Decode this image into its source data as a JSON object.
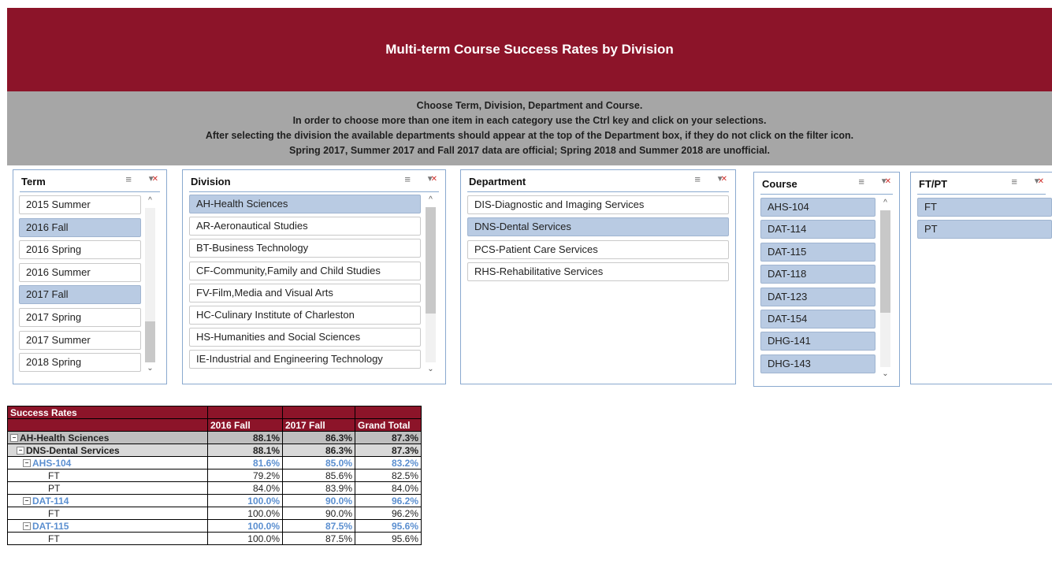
{
  "banner": {
    "title": "Multi-term Course Success Rates by Division"
  },
  "instructions": [
    "Choose Term, Division, Department and Course.",
    "In order to choose more than one item in each category use the Ctrl key and click on your selections.",
    "After selecting the division the available departments should appear at the top of the Department box, if they do not click on the filter icon.",
    "Spring 2017, Summer 2017 and Fall 2017 data are official; Spring 2018 and Summer 2018 are unofficial."
  ],
  "slicers": {
    "term": {
      "title": "Term",
      "items": [
        "2015 Summer",
        "2016 Fall",
        "2016 Spring",
        "2016 Summer",
        "2017 Fall",
        "2017 Spring",
        "2017 Summer",
        "2018 Spring"
      ],
      "selected": [
        1,
        4
      ]
    },
    "division": {
      "title": "Division",
      "items": [
        "AH-Health Sciences",
        "AR-Aeronautical Studies",
        "BT-Business Technology",
        "CF-Community,Family and Child Studies",
        "FV-Film,Media and Visual Arts",
        "HC-Culinary Institute of Charleston",
        "HS-Humanities and Social Sciences",
        "IE-Industrial and Engineering Technology"
      ],
      "selected": [
        0
      ]
    },
    "department": {
      "title": "Department",
      "items": [
        "DIS-Diagnostic and Imaging Services",
        "DNS-Dental Services",
        "PCS-Patient Care Services",
        "RHS-Rehabilitative Services"
      ],
      "selected": [
        1
      ]
    },
    "course": {
      "title": "Course",
      "items": [
        "AHS-104",
        "DAT-114",
        "DAT-115",
        "DAT-118",
        "DAT-123",
        "DAT-154",
        "DHG-141",
        "DHG-143"
      ],
      "selected": [
        0,
        1,
        2,
        3,
        4,
        5,
        6,
        7
      ]
    },
    "ftpt": {
      "title": "FT/PT",
      "items": [
        "FT",
        "PT"
      ],
      "selected": [
        0,
        1
      ]
    }
  },
  "icons": {
    "multiselect": "multi-select-icon",
    "clear_filter": "clear-filter-icon",
    "scroll_up": "chevron-up-icon",
    "scroll_down": "chevron-down-icon"
  },
  "pivot": {
    "title": "Success Rates",
    "columns": [
      "2016 Fall",
      "2017 Fall",
      "Grand Total"
    ],
    "rows": [
      {
        "level": "div",
        "label": "AH-Health Sciences",
        "values": [
          "88.1%",
          "86.3%",
          "87.3%"
        ]
      },
      {
        "level": "dept",
        "label": "DNS-Dental Services",
        "values": [
          "88.1%",
          "86.3%",
          "87.3%"
        ]
      },
      {
        "level": "course",
        "label": "AHS-104",
        "values": [
          "81.6%",
          "85.0%",
          "83.2%"
        ]
      },
      {
        "level": "leaf",
        "label": "FT",
        "values": [
          "79.2%",
          "85.6%",
          "82.5%"
        ]
      },
      {
        "level": "leaf",
        "label": "PT",
        "values": [
          "84.0%",
          "83.9%",
          "84.0%"
        ]
      },
      {
        "level": "course",
        "label": "DAT-114",
        "values": [
          "100.0%",
          "90.0%",
          "96.2%"
        ]
      },
      {
        "level": "leaf",
        "label": "FT",
        "values": [
          "100.0%",
          "90.0%",
          "96.2%"
        ]
      },
      {
        "level": "course",
        "label": "DAT-115",
        "values": [
          "100.0%",
          "87.5%",
          "95.6%"
        ]
      },
      {
        "level": "leaf",
        "label": "FT",
        "values": [
          "100.0%",
          "87.5%",
          "95.6%"
        ]
      }
    ]
  }
}
